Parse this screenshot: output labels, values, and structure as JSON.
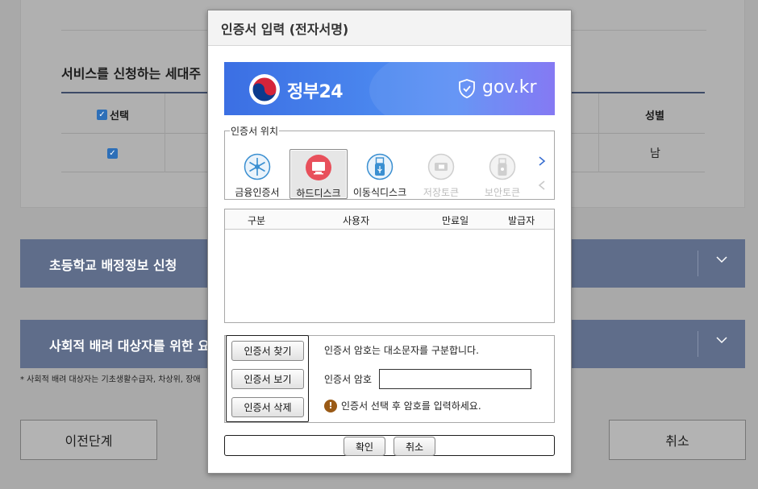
{
  "background": {
    "section_title": "서비스를 신청하는 세대주",
    "table_headers": {
      "select": "선택",
      "gender": "성별"
    },
    "row": {
      "gender": "남"
    },
    "bar1_title": "초등학교 배정정보 신청",
    "bar2_title": "사회적 배려 대상자를 위한 요",
    "note": "* 사회적 배려 대상자는 기초생활수급자, 차상위, 장애",
    "prev_button": "이전단계",
    "cancel_button": "취소"
  },
  "dialog": {
    "title": "인증서 입력 (전자서명)",
    "banner": {
      "brand": "정부24",
      "domain": "gov.kr"
    },
    "location_legend": "인증서 위치",
    "locations": [
      {
        "label": "금융인증서",
        "icon": "financial-cert-icon"
      },
      {
        "label": "하드디스크",
        "icon": "hard-disk-icon",
        "active": true
      },
      {
        "label": "이동식디스크",
        "icon": "usb-icon"
      },
      {
        "label": "저장토큰",
        "icon": "storage-token-icon",
        "disabled": true
      },
      {
        "label": "보안토큰",
        "icon": "security-token-icon",
        "disabled": true
      }
    ],
    "cert_table_headers": {
      "type": "구분",
      "user": "사용자",
      "expiry": "만료일",
      "issuer": "발급자"
    },
    "buttons": {
      "find": "인증서 찾기",
      "view": "인증서 보기",
      "delete": "인증서 삭제"
    },
    "case_hint": "인증서 암호는 대소문자를 구분합니다.",
    "password_label": "인증서 암호",
    "password_value": "",
    "warning": "인증서 선택 후 암호를 입력하세요.",
    "confirm": "확인",
    "cancel": "취소"
  },
  "colors": {
    "dim_background": "#a9a9a9",
    "bar": "#5f6d8a",
    "banner_start": "#3b6fe3",
    "banner_end": "#7b6ef2",
    "warning": "#9a5a16"
  }
}
